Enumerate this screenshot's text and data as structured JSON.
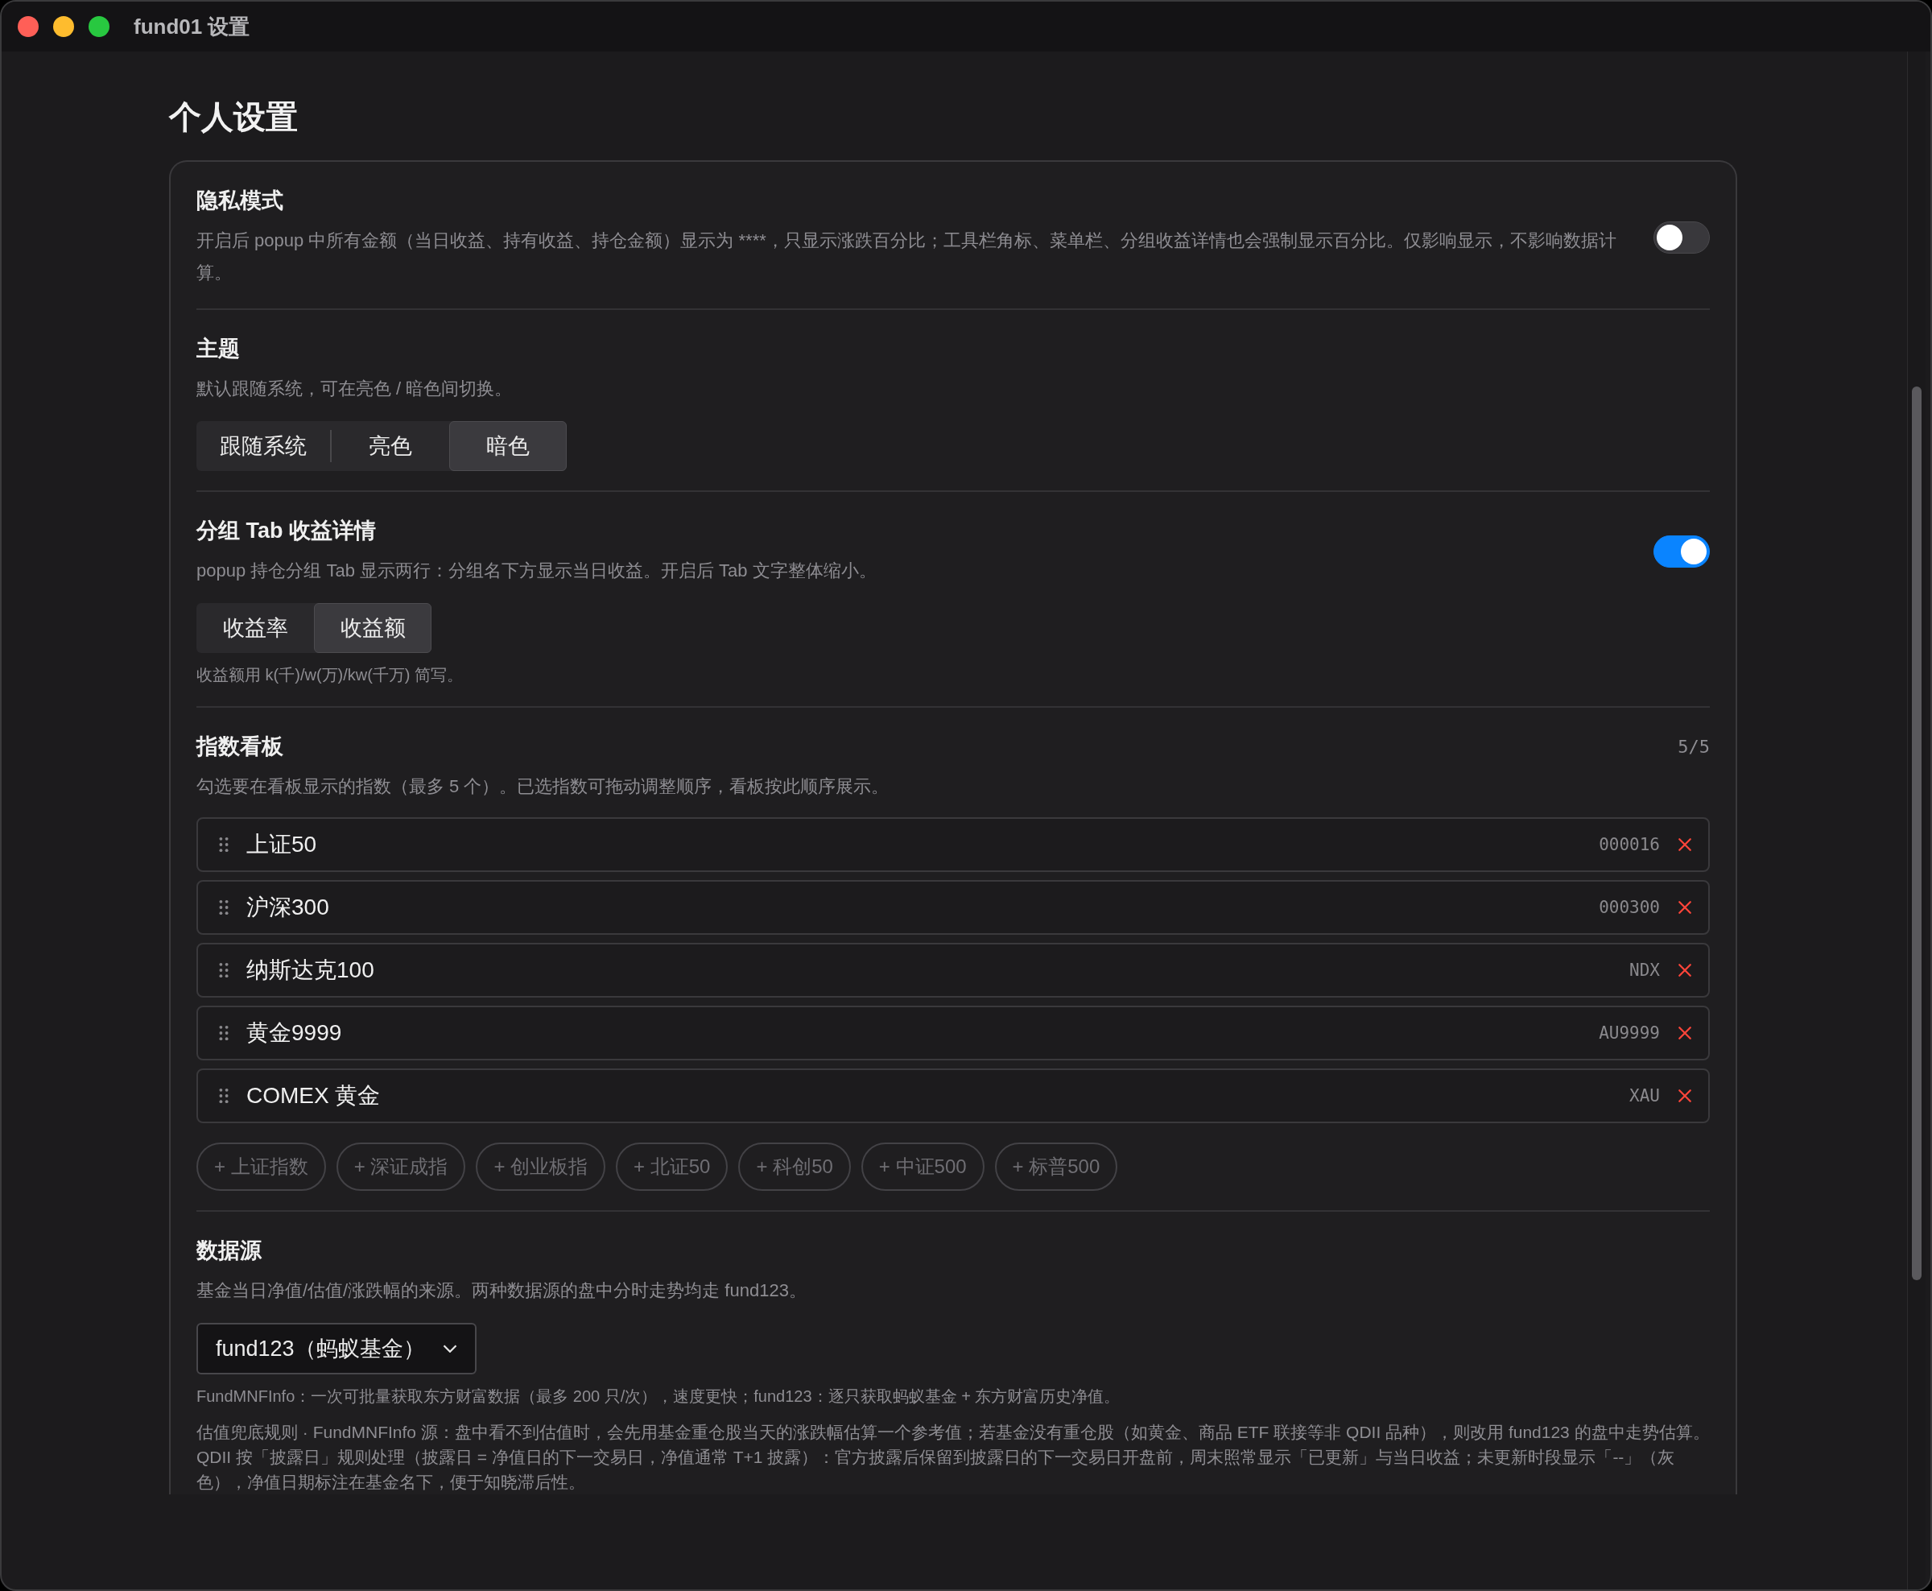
{
  "window": {
    "title": "fund01 设置"
  },
  "page": {
    "heading": "个人设置"
  },
  "privacy": {
    "title": "隐私模式",
    "description": "开启后 popup 中所有金额（当日收益、持有收益、持仓金额）显示为 ****，只显示涨跌百分比；工具栏角标、菜单栏、分组收益详情也会强制显示百分比。仅影响显示，不影响数据计算。",
    "on": false
  },
  "theme": {
    "title": "主题",
    "description": "默认跟随系统，可在亮色 / 暗色间切换。",
    "options": [
      {
        "label": "跟随系统",
        "selected": false
      },
      {
        "label": "亮色",
        "selected": false
      },
      {
        "label": "暗色",
        "selected": true
      }
    ]
  },
  "group_tab": {
    "title": "分组 Tab 收益详情",
    "description": "popup 持仓分组 Tab 显示两行：分组名下方显示当日收益。开启后 Tab 文字整体缩小。",
    "on": true,
    "options": [
      {
        "label": "收益率",
        "selected": false
      },
      {
        "label": "收益额",
        "selected": true
      }
    ],
    "note": "收益额用 k(千)/w(万)/kw(千万) 简写。"
  },
  "index_board": {
    "title": "指数看板",
    "count": "5/5",
    "description": "勾选要在看板显示的指数（最多 5 个）。已选指数可拖动调整顺序，看板按此顺序展示。",
    "items": [
      {
        "name": "上证50",
        "code": "000016"
      },
      {
        "name": "沪深300",
        "code": "000300"
      },
      {
        "name": "纳斯达克100",
        "code": "NDX"
      },
      {
        "name": "黄金9999",
        "code": "AU9999"
      },
      {
        "name": "COMEX 黄金",
        "code": "XAU"
      }
    ],
    "suggestions": [
      "+ 上证指数",
      "+ 深证成指",
      "+ 创业板指",
      "+ 北证50",
      "+ 科创50",
      "+ 中证500",
      "+ 标普500"
    ]
  },
  "data_source": {
    "title": "数据源",
    "description": "基金当日净值/估值/涨跌幅的来源。两种数据源的盘中分时走势均走 fund123。",
    "select": {
      "value": "fund123（蚂蚁基金）"
    },
    "note": "FundMNFInfo：一次可批量获取东方财富数据（最多 200 只/次），速度更快；fund123：逐只获取蚂蚁基金 + 东方财富历史净值。",
    "rules": "估值兜底规则 · FundMNFInfo 源：盘中看不到估值时，会先用基金重仓股当天的涨跌幅估算一个参考值；若基金没有重仓股（如黄金、商品 ETF 联接等非 QDII 品种），则改用 fund123 的盘中走势估算。QDII 按「披露日」规则处理（披露日 = 净值日的下一交易日，净值通常 T+1 披露）：官方披露后保留到披露日的下一交易日开盘前，周末照常显示「已更新」与当日收益；未更新时段显示「--」（灰色），净值日期标注在基金名下，便于知晓滞后性。"
  }
}
